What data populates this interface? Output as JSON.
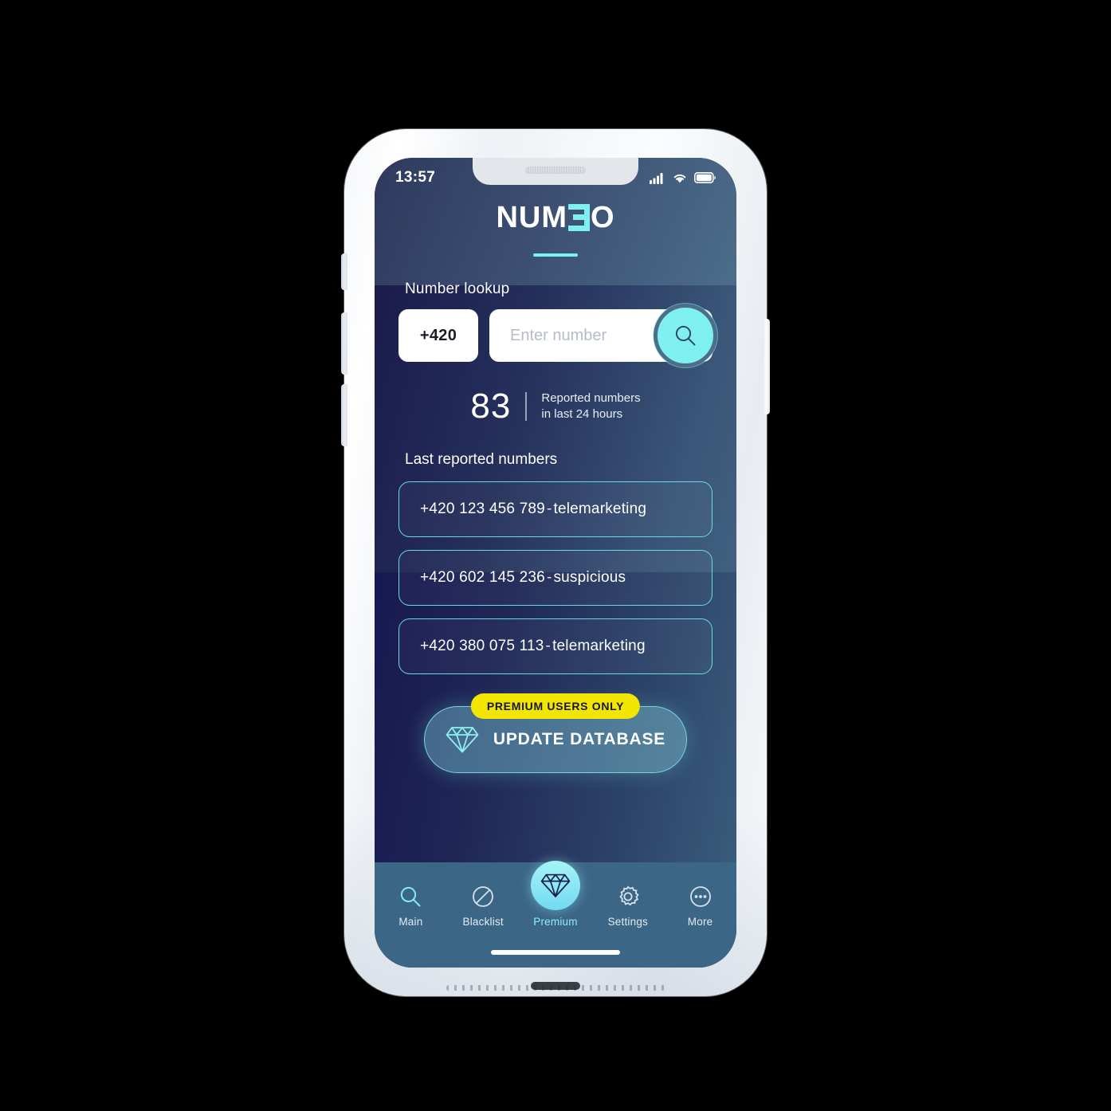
{
  "status_bar": {
    "time": "13:57",
    "icons": [
      "signal-icon",
      "wifi-icon",
      "battery-icon"
    ]
  },
  "brand": {
    "name_part1": "NUM",
    "mark": "reversed-e-icon",
    "name_part2": "O",
    "accent_color": "#7ef0ef"
  },
  "lookup": {
    "label": "Number lookup",
    "country_code": "+420",
    "input_value": "",
    "input_placeholder": "Enter number",
    "search_icon": "search-icon"
  },
  "stats": {
    "count": "83",
    "line1": "Reported numbers",
    "line2": "in last 24 hours"
  },
  "reports": {
    "label": "Last reported numbers",
    "items": [
      {
        "number": "+420 123 456 789",
        "separator": "-",
        "tag": "telemarketing"
      },
      {
        "number": "+420 602 145 236",
        "separator": "-",
        "tag": "suspicious"
      },
      {
        "number": "+420 380 075 113",
        "separator": "-",
        "tag": "telemarketing"
      }
    ]
  },
  "cta": {
    "badge": "PREMIUM USERS ONLY",
    "badge_color": "#f2e500",
    "icon": "diamond-icon",
    "label": "UPDATE DATABASE"
  },
  "tabbar": {
    "items": [
      {
        "label": "Main",
        "icon": "search-icon",
        "active": true
      },
      {
        "label": "Blacklist",
        "icon": "block-icon",
        "active": false
      },
      {
        "label": "Premium",
        "icon": "diamond-icon",
        "active": true
      },
      {
        "label": "Settings",
        "icon": "gear-icon",
        "active": false
      },
      {
        "label": "More",
        "icon": "ellipsis-icon",
        "active": false
      }
    ]
  }
}
